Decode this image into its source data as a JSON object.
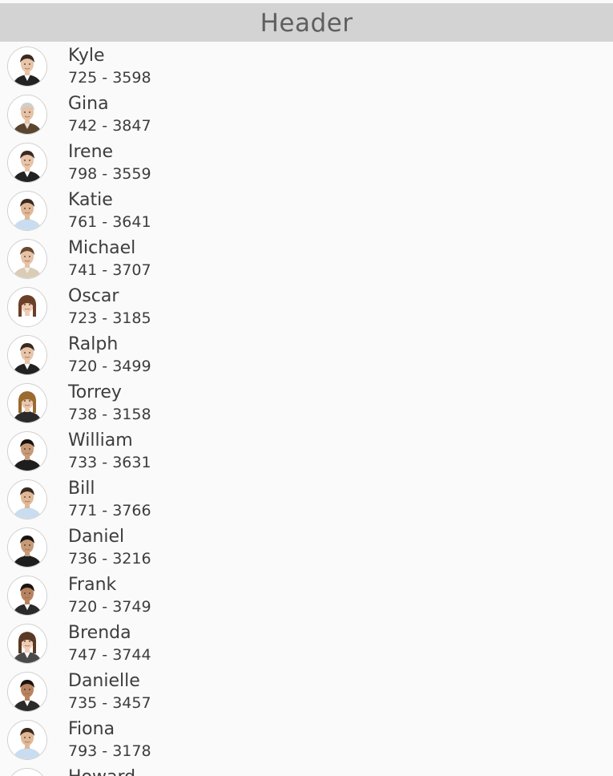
{
  "header": {
    "title": "Header"
  },
  "contacts": [
    {
      "name": "Kyle",
      "phone": "725 - 3598",
      "skin": "#e8c4a8",
      "hair": "#3a2a20",
      "suit": "#222222",
      "shirt": "#ffffff",
      "female": false
    },
    {
      "name": "Gina",
      "phone": "742 - 3847",
      "skin": "#e6c2a6",
      "hair": "#cfcfcf",
      "suit": "#5a4630",
      "shirt": "#e8e0d0",
      "female": false
    },
    {
      "name": "Irene",
      "phone": "798 - 3559",
      "skin": "#e8c4a8",
      "hair": "#3a2a20",
      "suit": "#222222",
      "shirt": "#ffffff",
      "female": false
    },
    {
      "name": "Katie",
      "phone": "761 - 3641",
      "skin": "#e0b896",
      "hair": "#3a2a20",
      "suit": "#c9dcf0",
      "shirt": "#c9dcf0",
      "female": false
    },
    {
      "name": "Michael",
      "phone": "741 - 3707",
      "skin": "#e6c2a6",
      "hair": "#6a4a30",
      "suit": "#d9cdb8",
      "shirt": "#f2eee6",
      "female": false
    },
    {
      "name": "Oscar",
      "phone": "723 - 3185",
      "skin": "#f0cdb4",
      "hair": "#6a4028",
      "suit": "#ffffff",
      "shirt": "#ffffff",
      "female": true
    },
    {
      "name": "Ralph",
      "phone": "720 - 3499",
      "skin": "#e8c4a8",
      "hair": "#3a2a20",
      "suit": "#222222",
      "shirt": "#ffffff",
      "female": false
    },
    {
      "name": "Torrey",
      "phone": "738 - 3158",
      "skin": "#eac6aa",
      "hair": "#9a6a30",
      "suit": "#2a2a2a",
      "shirt": "#2a2a2a",
      "female": true
    },
    {
      "name": "William",
      "phone": "733 - 3631",
      "skin": "#c89a78",
      "hair": "#1a1410",
      "suit": "#1e1e1e",
      "shirt": "#1e1e1e",
      "female": false
    },
    {
      "name": "Bill",
      "phone": "771 - 3766",
      "skin": "#e0b896",
      "hair": "#3a2a20",
      "suit": "#c9dcf0",
      "shirt": "#c9dcf0",
      "female": false
    },
    {
      "name": "Daniel",
      "phone": "736 - 3216",
      "skin": "#c89a78",
      "hair": "#1a1410",
      "suit": "#1e1e1e",
      "shirt": "#1e1e1e",
      "female": false
    },
    {
      "name": "Frank",
      "phone": "720 - 3749",
      "skin": "#b8835e",
      "hair": "#1a1410",
      "suit": "#2a2a2a",
      "shirt": "#ffffff",
      "female": false
    },
    {
      "name": "Brenda",
      "phone": "747 - 3744",
      "skin": "#f0cdb4",
      "hair": "#5a3a24",
      "suit": "#4a4a4a",
      "shirt": "#ffffff",
      "female": true
    },
    {
      "name": "Danielle",
      "phone": "735 - 3457",
      "skin": "#b8835e",
      "hair": "#1a1410",
      "suit": "#2a2a2a",
      "shirt": "#ffffff",
      "female": false
    },
    {
      "name": "Fiona",
      "phone": "793 - 3178",
      "skin": "#e0b896",
      "hair": "#3a2a20",
      "suit": "#c9dcf0",
      "shirt": "#c9dcf0",
      "female": false
    },
    {
      "name": "Howard",
      "phone": "",
      "skin": "#e6c2a6",
      "hair": "#8a8a8a",
      "suit": "#5a4630",
      "shirt": "#e8e0d0",
      "female": false
    }
  ]
}
